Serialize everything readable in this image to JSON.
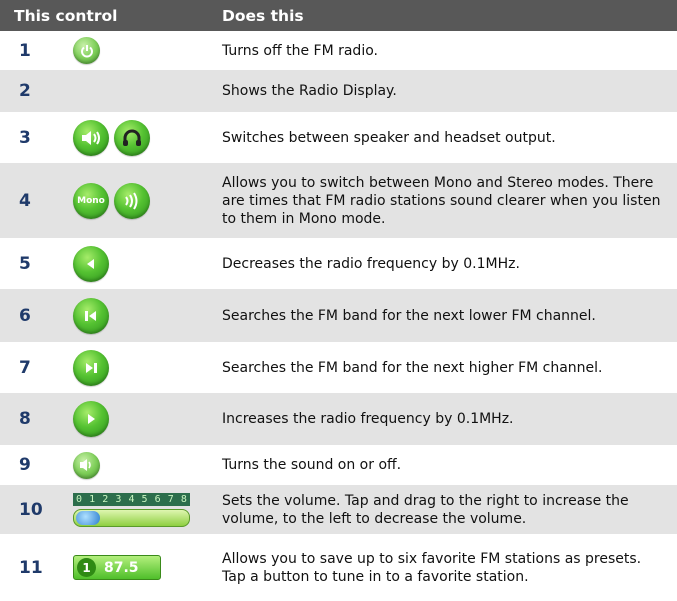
{
  "header": {
    "col1": "This control",
    "col2": "Does this"
  },
  "rows": [
    {
      "num": "1",
      "icons": [
        "power-icon"
      ],
      "desc": "Turns off the FM radio."
    },
    {
      "num": "2",
      "icons": [],
      "desc": "Shows the Radio Display."
    },
    {
      "num": "3",
      "icons": [
        "speaker-icon",
        "headset-icon"
      ],
      "desc": "Switches between speaker and headset output."
    },
    {
      "num": "4",
      "icons": [
        "mono-icon",
        "stereo-icon"
      ],
      "mono_label": "Mono",
      "desc": "Allows you to switch between Mono and Stereo modes. There are times that FM radio stations sound clearer when you listen to them in Mono mode."
    },
    {
      "num": "5",
      "icons": [
        "step-down-icon"
      ],
      "desc": "Decreases the radio frequency by 0.1MHz."
    },
    {
      "num": "6",
      "icons": [
        "seek-down-icon"
      ],
      "desc": "Searches the FM band for the next lower FM channel."
    },
    {
      "num": "7",
      "icons": [
        "seek-up-icon"
      ],
      "desc": "Searches the FM band for the next higher FM channel."
    },
    {
      "num": "8",
      "icons": [
        "step-up-icon"
      ],
      "desc": "Increases the radio frequency by 0.1MHz."
    },
    {
      "num": "9",
      "icons": [
        "sound-toggle-icon"
      ],
      "desc": "Turns the sound on or off."
    },
    {
      "num": "10",
      "icons": [
        "volume-slider-icon"
      ],
      "volume_scale": [
        "0",
        "1",
        "2",
        "3",
        "4",
        "5",
        "6",
        "7",
        "8"
      ],
      "desc": "Sets the volume. Tap and drag to the right to increase the volume, to the left to decrease the volume."
    },
    {
      "num": "11",
      "icons": [
        "preset-button-icon"
      ],
      "preset": {
        "number": "1",
        "frequency": "87.5"
      },
      "desc": "Allows you to save up to six favorite FM stations as presets. Tap a button to tune in to a favorite station."
    }
  ],
  "colors": {
    "header_bg": "#585858",
    "alt_row_bg": "#e3e3e3",
    "number_color": "#1f3a6a",
    "button_green": "#55c232"
  }
}
